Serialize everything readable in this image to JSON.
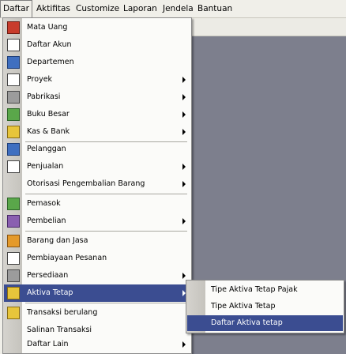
{
  "menubar": {
    "items": [
      {
        "label": "Daftar"
      },
      {
        "label": "Aktifitas"
      },
      {
        "label": "Customize"
      },
      {
        "label": "Laporan"
      },
      {
        "label": "Jendela"
      },
      {
        "label": "Bantuan"
      }
    ]
  },
  "menu": {
    "items": [
      {
        "label": "Mata Uang",
        "icon": "currency-icon"
      },
      {
        "label": "Daftar Akun",
        "icon": "accounts-icon"
      },
      {
        "label": "Departemen",
        "icon": "department-icon"
      },
      {
        "label": "Proyek",
        "icon": "project-icon"
      },
      {
        "label": "Pabrikasi",
        "icon": "manufacture-icon"
      },
      {
        "label": "Buku Besar",
        "icon": "ledger-icon"
      },
      {
        "label": "Kas & Bank",
        "icon": "cash-bank-icon"
      },
      {
        "label": "Pelanggan",
        "icon": "customer-icon"
      },
      {
        "label": "Penjualan",
        "icon": "sales-icon"
      },
      {
        "label": "Otorisasi Pengembalian Barang",
        "icon": ""
      },
      {
        "label": "Pemasok",
        "icon": "supplier-icon"
      },
      {
        "label": "Pembelian",
        "icon": "purchase-icon"
      },
      {
        "label": "Barang dan Jasa",
        "icon": "items-icon"
      },
      {
        "label": "Pembiayaan Pesanan",
        "icon": "order-cost-icon"
      },
      {
        "label": "Persediaan",
        "icon": "inventory-icon"
      },
      {
        "label": "Aktiva Tetap",
        "icon": "fixed-asset-icon"
      },
      {
        "label": "Transaksi berulang",
        "icon": "recurring-icon"
      },
      {
        "label": "Salinan Transaksi",
        "icon": ""
      },
      {
        "label": "Daftar Lain",
        "icon": ""
      }
    ]
  },
  "submenu": {
    "items": [
      {
        "label": "Tipe Aktiva Tetap Pajak"
      },
      {
        "label": "Tipe Aktiva Tetap"
      },
      {
        "label": "Daftar Aktiva tetap"
      }
    ]
  }
}
